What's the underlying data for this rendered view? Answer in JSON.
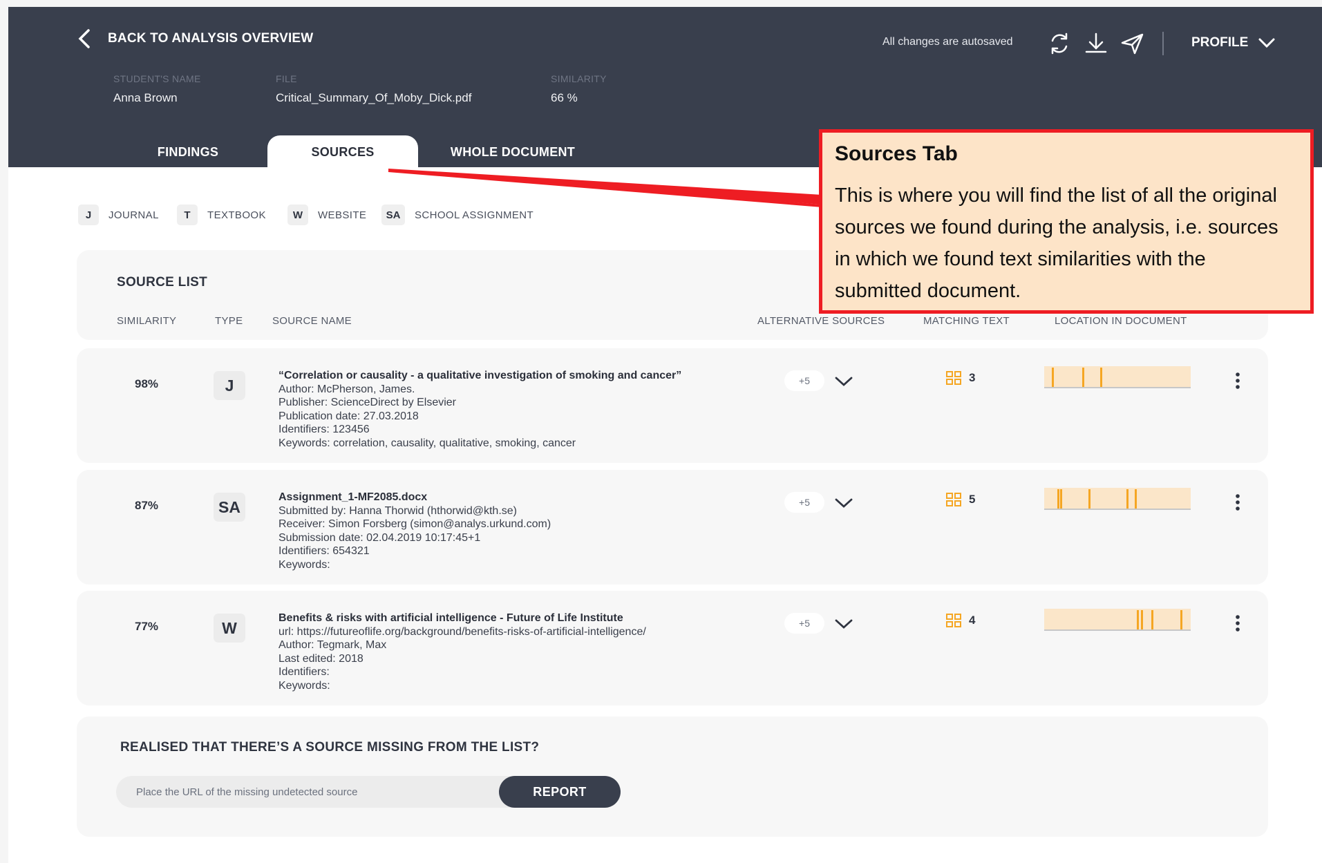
{
  "header": {
    "back_label": "BACK TO ANALYSIS OVERVIEW",
    "autosave": "All changes are autosaved",
    "profile_label": "PROFILE"
  },
  "meta": {
    "student_label": "STUDENT'S NAME",
    "student_value": "Anna Brown",
    "file_label": "FILE",
    "file_value": "Critical_Summary_Of_Moby_Dick.pdf",
    "similarity_label": "SIMILARITY",
    "similarity_value": "66 %"
  },
  "tabs": [
    {
      "label": "FINDINGS",
      "active": false
    },
    {
      "label": "SOURCES",
      "active": true
    },
    {
      "label": "WHOLE DOCUMENT",
      "active": false
    }
  ],
  "legend": [
    {
      "badge": "J",
      "label": "JOURNAL"
    },
    {
      "badge": "T",
      "label": "TEXTBOOK"
    },
    {
      "badge": "W",
      "label": "WEBSITE"
    },
    {
      "badge": "SA",
      "label": "SCHOOL ASSIGNMENT"
    }
  ],
  "source_list": {
    "title": "SOURCE LIST",
    "columns": {
      "similarity": "SIMILARITY",
      "type": "TYPE",
      "source_name": "SOURCE NAME",
      "alternative": "ALTERNATIVE SOURCES",
      "matching": "MATCHING TEXT",
      "location": "LOCATION IN DOCUMENT"
    },
    "rows": [
      {
        "similarity": "98%",
        "type": "J",
        "name": "“Correlation or causality - a qualitative investigation of smoking and cancer”",
        "details": [
          "Author: McPherson, James.",
          "Publisher: ScienceDirect by Elsevier",
          "Publication date: 27.03.2018",
          "Identifiers: 123456",
          "Keywords: correlation, causality, qualitative, smoking, cancer"
        ],
        "alternative": "+5",
        "matching": "3",
        "location_markers": [
          0.05,
          0.26,
          0.38
        ]
      },
      {
        "similarity": "87%",
        "type": "SA",
        "name": "Assignment_1-MF2085.docx",
        "details": [
          "Submitted by: Hanna Thorwid (hthorwid@kth.se)",
          "Receiver: Simon Forsberg (simon@analys.urkund.com)",
          "Submission date: 02.04.2019 10:17:45+1",
          "Identifiers: 654321",
          "Keywords:"
        ],
        "alternative": "+5",
        "matching": "5",
        "location_markers": [
          0.09,
          0.11,
          0.3,
          0.56,
          0.62
        ]
      },
      {
        "similarity": "77%",
        "type": "W",
        "name": "Benefits & risks with artificial intelligence - Future of Life Institute",
        "details": [
          "url: https://futureoflife.org/background/benefits-risks-of-artificial-intelligence/",
          "Author: Tegmark, Max",
          "Last edited: 2018",
          "Identifiers:",
          "Keywords:"
        ],
        "alternative": "+5",
        "matching": "4",
        "location_markers": [
          0.63,
          0.66,
          0.73,
          0.93
        ]
      }
    ]
  },
  "missing": {
    "question": "REALISED THAT THERE’S A SOURCE MISSING FROM THE LIST?",
    "placeholder": "Place the URL of the missing undetected source",
    "button": "REPORT"
  },
  "callout": {
    "title": "Sources Tab",
    "body": "This is where you will find the list of all the original sources we found during the analysis, i.e. sources in which we found text similarities with the submitted document."
  },
  "colors": {
    "header_bg": "#393f4d",
    "accent_orange": "#f5a623",
    "callout_bg": "#fde4c8",
    "callout_border": "#ee1d23"
  }
}
